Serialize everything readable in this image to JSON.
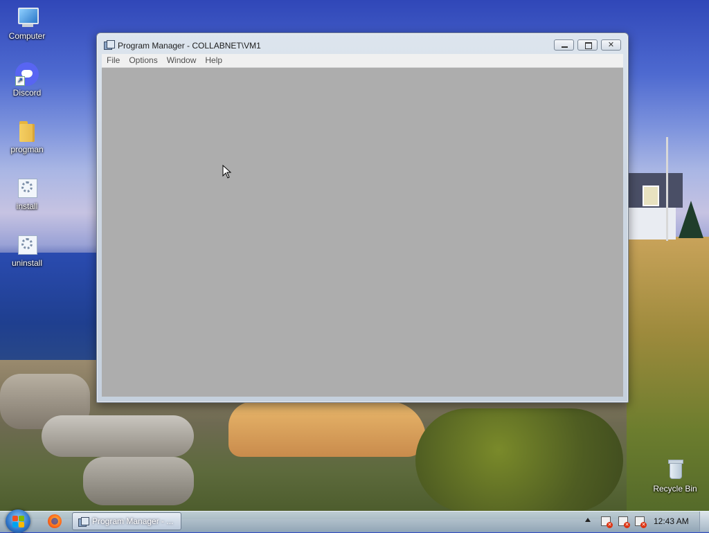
{
  "desktop": {
    "icons": [
      {
        "label": "Computer",
        "icon": "computer-icon"
      },
      {
        "label": "Discord",
        "icon": "discord-icon"
      },
      {
        "label": "progman",
        "icon": "folder-icon"
      },
      {
        "label": "install",
        "icon": "setup-icon"
      },
      {
        "label": "uninstall",
        "icon": "setup-icon"
      }
    ],
    "recycle_bin": {
      "label": "Recycle Bin",
      "icon": "recycle-bin-icon"
    }
  },
  "window": {
    "title": "Program Manager - COLLABNET\\VM1",
    "menu": [
      "File",
      "Options",
      "Window",
      "Help"
    ],
    "client_color": "#adadad"
  },
  "taskbar": {
    "task_button_label": "Program Manager - ...",
    "clock": "12:43 AM",
    "tray_icons": [
      "action-center-flag-icon",
      "network-icon",
      "volume-icon"
    ]
  }
}
